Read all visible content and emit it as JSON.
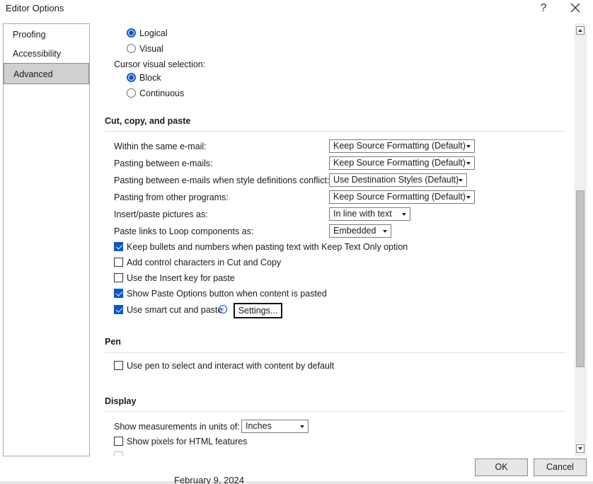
{
  "window": {
    "title": "Editor Options",
    "help_glyph": "?",
    "close_icon": "close-icon"
  },
  "nav": {
    "items": [
      {
        "label": "Proofing"
      },
      {
        "label": "Accessibility"
      },
      {
        "label": "Advanced",
        "selected": true
      }
    ]
  },
  "direction": {
    "options": [
      {
        "label": "Logical",
        "checked": true
      },
      {
        "label": "Visual",
        "checked": false
      }
    ]
  },
  "cursor": {
    "label": "Cursor visual selection:",
    "options": [
      {
        "label": "Block",
        "checked": true
      },
      {
        "label": "Continuous",
        "checked": false
      }
    ]
  },
  "cut_copy_paste": {
    "title": "Cut, copy, and paste",
    "rows": [
      {
        "label": "Within the same e-mail:",
        "value": "Keep Source Formatting (Default)"
      },
      {
        "label": "Pasting between e-mails:",
        "value": "Keep Source Formatting (Default)"
      },
      {
        "label": "Pasting between e-mails when style definitions conflict:",
        "value": "Use Destination Styles (Default)"
      },
      {
        "label": "Pasting from other programs:",
        "value": "Keep Source Formatting (Default)"
      },
      {
        "label": "Insert/paste pictures as:",
        "value": "In line with text"
      },
      {
        "label": "Paste links to Loop components as:",
        "value": "Embedded"
      }
    ],
    "checkboxes": [
      {
        "label": "Keep bullets and numbers when pasting text with Keep Text Only option",
        "checked": true
      },
      {
        "label": "Add control characters in Cut and Copy",
        "checked": false
      },
      {
        "label": "Use the Insert key for paste",
        "checked": false
      },
      {
        "label": "Show Paste Options button when content is pasted",
        "checked": true
      },
      {
        "label": "Use smart cut and paste",
        "checked": true
      }
    ],
    "settings_button": "Settings...",
    "info_glyph": "i"
  },
  "pen": {
    "title": "Pen",
    "checkbox": {
      "label": "Use pen to select and interact with content by default",
      "checked": false
    }
  },
  "display": {
    "title": "Display",
    "measure_label": "Show measurements in units of:",
    "measure_value": "Inches",
    "pixels_checkbox": {
      "label": "Show pixels for HTML features",
      "checked": false
    }
  },
  "footer": {
    "ok": "OK",
    "cancel": "Cancel"
  },
  "behind_window_text": "February 9, 2024"
}
